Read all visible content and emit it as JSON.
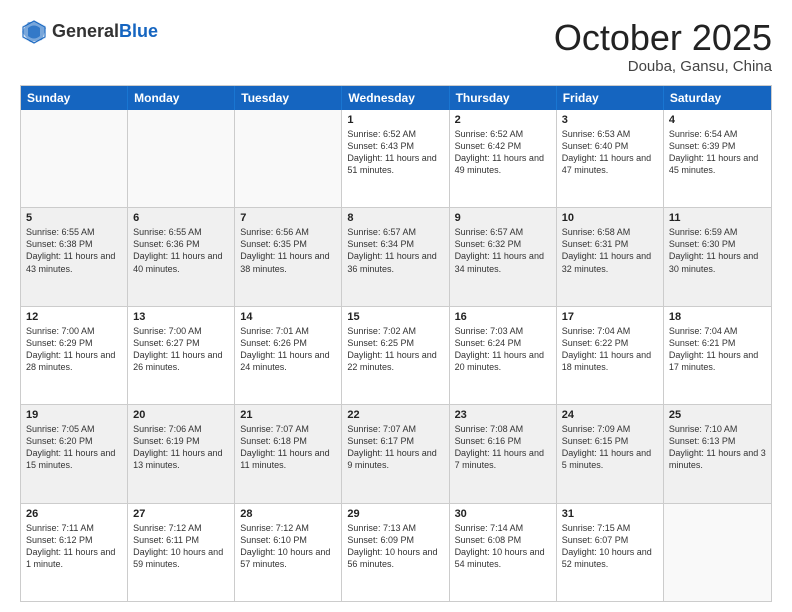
{
  "header": {
    "logo_general": "General",
    "logo_blue": "Blue",
    "month_title": "October 2025",
    "location": "Douba, Gansu, China"
  },
  "weekdays": [
    "Sunday",
    "Monday",
    "Tuesday",
    "Wednesday",
    "Thursday",
    "Friday",
    "Saturday"
  ],
  "rows": [
    [
      {
        "day": "",
        "text": ""
      },
      {
        "day": "",
        "text": ""
      },
      {
        "day": "",
        "text": ""
      },
      {
        "day": "1",
        "text": "Sunrise: 6:52 AM\nSunset: 6:43 PM\nDaylight: 11 hours\nand 51 minutes."
      },
      {
        "day": "2",
        "text": "Sunrise: 6:52 AM\nSunset: 6:42 PM\nDaylight: 11 hours\nand 49 minutes."
      },
      {
        "day": "3",
        "text": "Sunrise: 6:53 AM\nSunset: 6:40 PM\nDaylight: 11 hours\nand 47 minutes."
      },
      {
        "day": "4",
        "text": "Sunrise: 6:54 AM\nSunset: 6:39 PM\nDaylight: 11 hours\nand 45 minutes."
      }
    ],
    [
      {
        "day": "5",
        "text": "Sunrise: 6:55 AM\nSunset: 6:38 PM\nDaylight: 11 hours\nand 43 minutes."
      },
      {
        "day": "6",
        "text": "Sunrise: 6:55 AM\nSunset: 6:36 PM\nDaylight: 11 hours\nand 40 minutes."
      },
      {
        "day": "7",
        "text": "Sunrise: 6:56 AM\nSunset: 6:35 PM\nDaylight: 11 hours\nand 38 minutes."
      },
      {
        "day": "8",
        "text": "Sunrise: 6:57 AM\nSunset: 6:34 PM\nDaylight: 11 hours\nand 36 minutes."
      },
      {
        "day": "9",
        "text": "Sunrise: 6:57 AM\nSunset: 6:32 PM\nDaylight: 11 hours\nand 34 minutes."
      },
      {
        "day": "10",
        "text": "Sunrise: 6:58 AM\nSunset: 6:31 PM\nDaylight: 11 hours\nand 32 minutes."
      },
      {
        "day": "11",
        "text": "Sunrise: 6:59 AM\nSunset: 6:30 PM\nDaylight: 11 hours\nand 30 minutes."
      }
    ],
    [
      {
        "day": "12",
        "text": "Sunrise: 7:00 AM\nSunset: 6:29 PM\nDaylight: 11 hours\nand 28 minutes."
      },
      {
        "day": "13",
        "text": "Sunrise: 7:00 AM\nSunset: 6:27 PM\nDaylight: 11 hours\nand 26 minutes."
      },
      {
        "day": "14",
        "text": "Sunrise: 7:01 AM\nSunset: 6:26 PM\nDaylight: 11 hours\nand 24 minutes."
      },
      {
        "day": "15",
        "text": "Sunrise: 7:02 AM\nSunset: 6:25 PM\nDaylight: 11 hours\nand 22 minutes."
      },
      {
        "day": "16",
        "text": "Sunrise: 7:03 AM\nSunset: 6:24 PM\nDaylight: 11 hours\nand 20 minutes."
      },
      {
        "day": "17",
        "text": "Sunrise: 7:04 AM\nSunset: 6:22 PM\nDaylight: 11 hours\nand 18 minutes."
      },
      {
        "day": "18",
        "text": "Sunrise: 7:04 AM\nSunset: 6:21 PM\nDaylight: 11 hours\nand 17 minutes."
      }
    ],
    [
      {
        "day": "19",
        "text": "Sunrise: 7:05 AM\nSunset: 6:20 PM\nDaylight: 11 hours\nand 15 minutes."
      },
      {
        "day": "20",
        "text": "Sunrise: 7:06 AM\nSunset: 6:19 PM\nDaylight: 11 hours\nand 13 minutes."
      },
      {
        "day": "21",
        "text": "Sunrise: 7:07 AM\nSunset: 6:18 PM\nDaylight: 11 hours\nand 11 minutes."
      },
      {
        "day": "22",
        "text": "Sunrise: 7:07 AM\nSunset: 6:17 PM\nDaylight: 11 hours\nand 9 minutes."
      },
      {
        "day": "23",
        "text": "Sunrise: 7:08 AM\nSunset: 6:16 PM\nDaylight: 11 hours\nand 7 minutes."
      },
      {
        "day": "24",
        "text": "Sunrise: 7:09 AM\nSunset: 6:15 PM\nDaylight: 11 hours\nand 5 minutes."
      },
      {
        "day": "25",
        "text": "Sunrise: 7:10 AM\nSunset: 6:13 PM\nDaylight: 11 hours\nand 3 minutes."
      }
    ],
    [
      {
        "day": "26",
        "text": "Sunrise: 7:11 AM\nSunset: 6:12 PM\nDaylight: 11 hours\nand 1 minute."
      },
      {
        "day": "27",
        "text": "Sunrise: 7:12 AM\nSunset: 6:11 PM\nDaylight: 10 hours\nand 59 minutes."
      },
      {
        "day": "28",
        "text": "Sunrise: 7:12 AM\nSunset: 6:10 PM\nDaylight: 10 hours\nand 57 minutes."
      },
      {
        "day": "29",
        "text": "Sunrise: 7:13 AM\nSunset: 6:09 PM\nDaylight: 10 hours\nand 56 minutes."
      },
      {
        "day": "30",
        "text": "Sunrise: 7:14 AM\nSunset: 6:08 PM\nDaylight: 10 hours\nand 54 minutes."
      },
      {
        "day": "31",
        "text": "Sunrise: 7:15 AM\nSunset: 6:07 PM\nDaylight: 10 hours\nand 52 minutes."
      },
      {
        "day": "",
        "text": ""
      }
    ]
  ]
}
